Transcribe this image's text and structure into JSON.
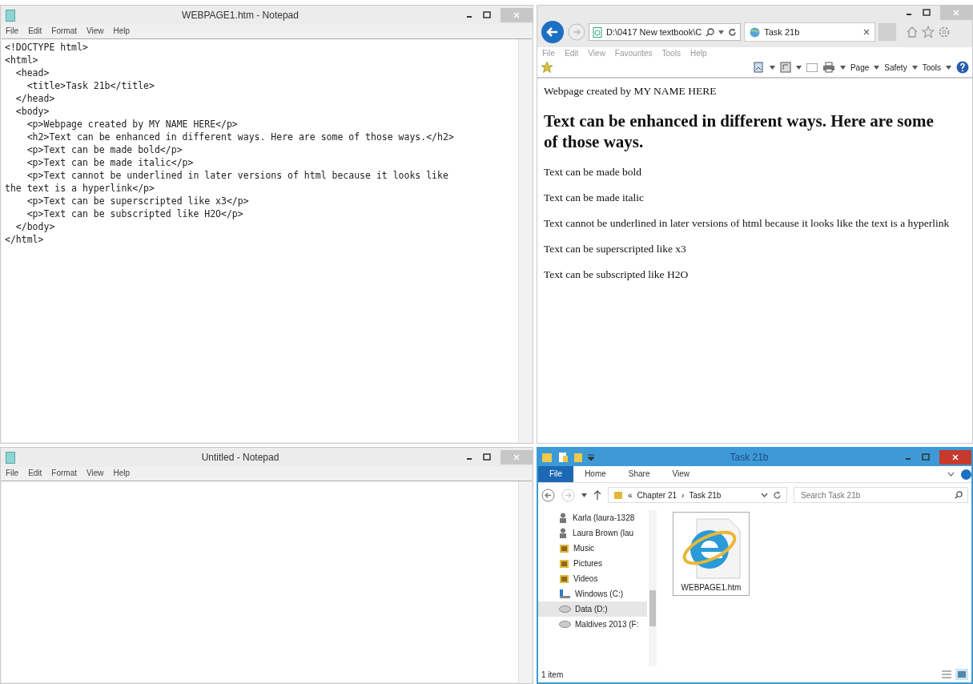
{
  "notepad_main": {
    "title": "WEBPAGE1.htm - Notepad",
    "menu": [
      "File",
      "Edit",
      "Format",
      "View",
      "Help"
    ],
    "lines": [
      "<!DOCTYPE html>",
      "<html>",
      "  <head>",
      "    <title>Task 21b</title>",
      "  </head>",
      "  <body>",
      "    <p>Webpage created by MY NAME HERE</p>",
      "    <h2>Text can be enhanced in different ways. Here are some of those ways.</h2>",
      "    <p>Text can be made bold</p>",
      "    <p>Text can be made italic</p>",
      "    <p>Text cannot be underlined in later versions of html because it looks like",
      "the text is a hyperlink</p>",
      "    <p>Text can be superscripted like x3</p>",
      "    <p>Text can be subscripted like H2O</p>",
      "  </body>",
      "</html>"
    ]
  },
  "browser": {
    "address": "D:\\0417 New textbook\\C",
    "tab": {
      "title": "Task 21b"
    },
    "menu": [
      "File",
      "Edit",
      "View",
      "Favourites",
      "Tools",
      "Help"
    ],
    "commands": [
      "Page",
      "Safety",
      "Tools"
    ],
    "page": {
      "intro": "Webpage created by MY NAME HERE",
      "heading": "Text can be enhanced in different ways. Here are some of those ways.",
      "paragraphs": [
        "Text can be made bold",
        "Text can be made italic",
        "Text cannot be underlined in later versions of html because it looks like the text is a hyperlink",
        "Text can be superscripted like x3",
        "Text can be subscripted like H2O"
      ]
    }
  },
  "notepad_untitled": {
    "title": "Untitled - Notepad",
    "menu": [
      "File",
      "Edit",
      "Format",
      "View",
      "Help"
    ]
  },
  "explorer": {
    "title": "Task 21b",
    "ribbon_tabs": [
      {
        "label": "File",
        "selected": true
      },
      {
        "label": "Home",
        "selected": false
      },
      {
        "label": "Share",
        "selected": false
      },
      {
        "label": "View",
        "selected": false
      }
    ],
    "breadcrumb": [
      "«",
      "Chapter 21",
      "›",
      "Task 21b"
    ],
    "search": {
      "placeholder": "Search Task 21b"
    },
    "nav_items": [
      {
        "label": "Karla (laura-1328",
        "kind": "user",
        "selected": false
      },
      {
        "label": "Laura Brown (lau",
        "kind": "user",
        "selected": false
      },
      {
        "label": "Music",
        "kind": "folder",
        "selected": false
      },
      {
        "label": "Pictures",
        "kind": "folder",
        "selected": false
      },
      {
        "label": "Videos",
        "kind": "folder",
        "selected": false
      },
      {
        "label": "Windows (C:)",
        "kind": "system-drive",
        "selected": false
      },
      {
        "label": "Data (D:)",
        "kind": "drive",
        "selected": true
      },
      {
        "label": "Maldives 2013 (F:",
        "kind": "drive",
        "selected": false
      }
    ],
    "files": [
      {
        "name": "WEBPAGE1.htm"
      }
    ],
    "status_bar": "1 item"
  }
}
